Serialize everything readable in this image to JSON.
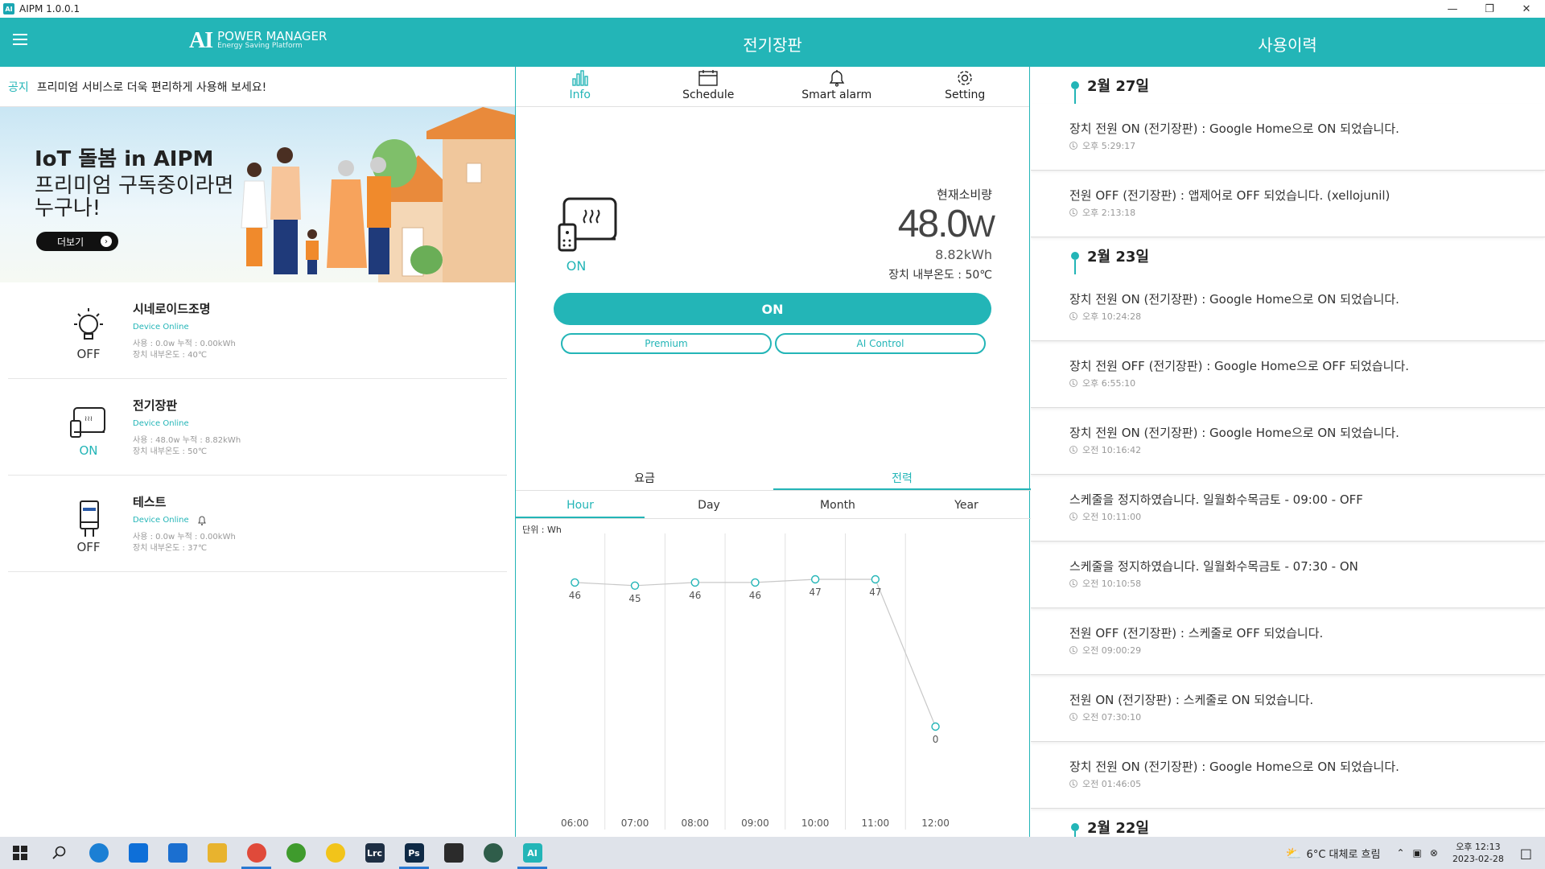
{
  "window": {
    "title": "AIPM 1.0.0.1",
    "app_icon": "AI"
  },
  "header": {
    "logo_mark": "AI",
    "logo_line1": "POWER MANAGER",
    "logo_line2": "Energy Saving Platform",
    "center_title": "전기장판",
    "right_title": "사용이력",
    "color": "#23b5b7"
  },
  "notice": {
    "tag": "공지",
    "text": "프리미엄 서비스로 더욱 편리하게 사용해 보세요!"
  },
  "banner": {
    "title": "IoT 돌봄 in AIPM",
    "subtitle": "프리미엄 구독중이라면 누구나!",
    "button": "더보기"
  },
  "devices": [
    {
      "name": "시네로이드조명",
      "status": "Device Online",
      "usage": "사용 : 0.0w   누적 : 0.00kWh",
      "temp": "장치 내부온도 : 40℃",
      "state": "OFF",
      "icon": "bulb-icon"
    },
    {
      "name": "전기장판",
      "status": "Device Online",
      "usage": "사용 : 48.0w   누적 : 8.82kWh",
      "temp": "장치 내부온도 : 50℃",
      "state": "ON",
      "icon": "heater-icon"
    },
    {
      "name": "테스트",
      "status": "Device Online",
      "usage": "사용 : 0.0w   누적 : 0.00kWh",
      "temp": "장치 내부온도 : 37℃",
      "state": "OFF",
      "icon": "plug-icon"
    }
  ],
  "tabs": [
    {
      "label": "Info",
      "icon": "chart-icon"
    },
    {
      "label": "Schedule",
      "icon": "calendar-icon"
    },
    {
      "label": "Smart alarm",
      "icon": "bell-icon"
    },
    {
      "label": "Setting",
      "icon": "gear-icon"
    }
  ],
  "device_detail": {
    "state": "ON",
    "current_label": "현재소비량",
    "current_value": "48.0",
    "current_unit": "W",
    "kwh": "8.82kWh",
    "temp": "장치 내부온도 : 50℃",
    "on_button": "ON",
    "premium": "Premium",
    "ai_control": "AI Control"
  },
  "chart_tabs": {
    "fee": "요금",
    "power": "전력"
  },
  "period_tabs": [
    "Hour",
    "Day",
    "Month",
    "Year"
  ],
  "chart_data": {
    "type": "line",
    "ylabel": "단위 : Wh",
    "x": [
      "06:00",
      "07:00",
      "08:00",
      "09:00",
      "10:00",
      "11:00",
      "12:00"
    ],
    "values": [
      46,
      45,
      46,
      46,
      47,
      47,
      0
    ],
    "color": "#23b5b7"
  },
  "history": [
    {
      "date": "2월 27일",
      "entries": [
        {
          "msg": "장치 전원 ON (전기장판) : Google Home으로 ON 되었습니다.",
          "time": "오후 5:29:17"
        },
        {
          "msg": "전원 OFF (전기장판) : 앱제어로 OFF 되었습니다. (xellojunil)",
          "time": "오후 2:13:18"
        }
      ]
    },
    {
      "date": "2월 23일",
      "entries": [
        {
          "msg": "장치 전원 ON (전기장판) : Google Home으로 ON 되었습니다.",
          "time": "오후 10:24:28"
        },
        {
          "msg": "장치 전원 OFF (전기장판) : Google Home으로 OFF 되었습니다.",
          "time": "오후 6:55:10"
        },
        {
          "msg": "장치 전원 ON (전기장판) : Google Home으로 ON 되었습니다.",
          "time": "오전 10:16:42"
        },
        {
          "msg": "스케줄을 정지하였습니다. 일월화수목금토 - 09:00 - OFF",
          "time": "오전 10:11:00"
        },
        {
          "msg": "스케줄을 정지하였습니다. 일월화수목금토 - 07:30 - ON",
          "time": "오전 10:10:58"
        },
        {
          "msg": "전원 OFF (전기장판) : 스케줄로 OFF 되었습니다.",
          "time": "오전 09:00:29"
        },
        {
          "msg": "전원 ON (전기장판) : 스케줄로 ON 되었습니다.",
          "time": "오전 07:30:10"
        },
        {
          "msg": "장치 전원 ON (전기장판) : Google Home으로 ON 되었습니다.",
          "time": "오전 01:46:05"
        }
      ]
    },
    {
      "date": "2월 22일",
      "entries": []
    }
  ],
  "taskbar": {
    "weather": "6°C  대체로 흐림",
    "time": "오후 12:13",
    "date": "2023-02-28",
    "apps": [
      {
        "name": "start-icon",
        "color": "#1e1e1e",
        "label": ""
      },
      {
        "name": "search-icon",
        "color": "#1e1e1e",
        "label": ""
      },
      {
        "name": "edge-icon",
        "color": "#1b7fd4",
        "label": ""
      },
      {
        "name": "teamviewer-icon",
        "color": "#0e6fd8",
        "label": ""
      },
      {
        "name": "bluetooth-app-icon",
        "color": "#1b6fd0",
        "label": ""
      },
      {
        "name": "folder-icon",
        "color": "#e8b32e",
        "label": ""
      },
      {
        "name": "chrome-icon",
        "color": "#e04a3a",
        "label": ""
      },
      {
        "name": "utorrent-icon",
        "color": "#3f9b2d",
        "label": ""
      },
      {
        "name": "player-icon",
        "color": "#f2c41a",
        "label": ""
      },
      {
        "name": "lightroom-icon",
        "color": "#1e2f44",
        "label": "Lrc"
      },
      {
        "name": "photoshop-icon",
        "color": "#0f2a46",
        "label": "Ps"
      },
      {
        "name": "sticky-icon",
        "color": "#2b2b2b",
        "label": ""
      },
      {
        "name": "globe-icon",
        "color": "#2f5d4a",
        "label": ""
      },
      {
        "name": "aipm-icon",
        "color": "#23b5b7",
        "label": "AI"
      }
    ]
  }
}
